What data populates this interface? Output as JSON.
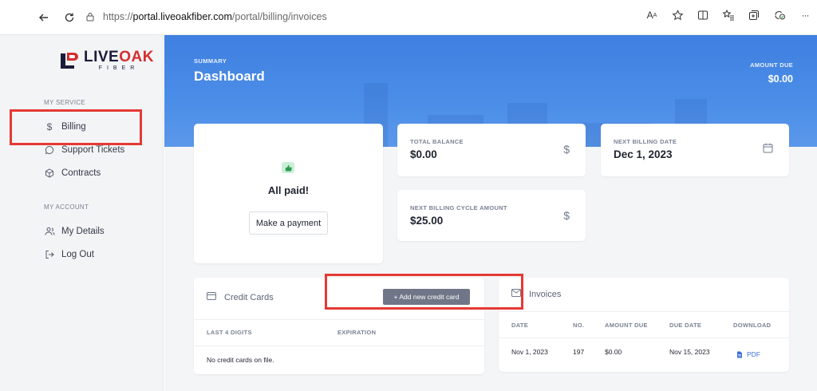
{
  "browser": {
    "url_prefix": "https://",
    "url_domain": "portal.liveoakfiber.com",
    "url_path": "/portal/billing/invoices",
    "icons": [
      "back-icon",
      "refresh-icon",
      "lock-icon",
      "read-aloud-icon",
      "favorite-icon",
      "split-screen-icon",
      "favorites-bar-icon",
      "collections-icon",
      "extensions-icon",
      "more-icon"
    ],
    "read_aloud_label": "A",
    "more_label": "···"
  },
  "logo": {
    "word_live": "LIVE",
    "word_oak": "OAK",
    "sub": "FIBER"
  },
  "sidebar": {
    "my_service_label": "MY SERVICE",
    "my_account_label": "MY ACCOUNT",
    "items": [
      {
        "label": "Billing",
        "icon": "dollar-icon"
      },
      {
        "label": "Support Tickets",
        "icon": "chat-bubble-icon"
      },
      {
        "label": "Contracts",
        "icon": "box-icon"
      },
      {
        "label": "My Details",
        "icon": "users-icon"
      },
      {
        "label": "Log Out",
        "icon": "logout-icon"
      }
    ]
  },
  "hero": {
    "summary_label": "SUMMARY",
    "title": "Dashboard",
    "amount_due_label": "AMOUNT DUE",
    "amount_due": "$0.00"
  },
  "status_card": {
    "title": "All paid!",
    "button": "Make a payment"
  },
  "stats": [
    {
      "label": "TOTAL BALANCE",
      "value": "$0.00",
      "icon": "dollar-icon"
    },
    {
      "label": "NEXT BILLING DATE",
      "value": "Dec 1, 2023",
      "icon": "calendar-icon"
    },
    {
      "label": "NEXT BILLING CYCLE AMOUNT",
      "value": "$25.00",
      "icon": "dollar-icon"
    }
  ],
  "credit_cards": {
    "title": "Credit Cards",
    "add_button": "+ Add new credit card",
    "columns": [
      "LAST 4 DIGITS",
      "EXPIRATION"
    ],
    "empty_text": "No credit cards on file."
  },
  "invoices": {
    "title": "Invoices",
    "columns": [
      "DATE",
      "NO.",
      "AMOUNT DUE",
      "DUE DATE",
      "DOWNLOAD"
    ],
    "rows": [
      {
        "date": "Nov 1, 2023",
        "no": "197",
        "amount_due": "$0.00",
        "due_date": "Nov 15, 2023",
        "download": "PDF"
      }
    ]
  },
  "colors": {
    "accent": "#4b8ee8",
    "brand_red": "#d32f2f",
    "annotation_red": "#e53935",
    "link": "#3b6fd8"
  }
}
